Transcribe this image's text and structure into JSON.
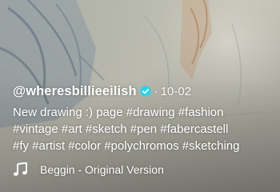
{
  "post": {
    "username": "@wheresbillieeilish",
    "verified": true,
    "separator": "·",
    "date": "10-02",
    "caption_lines": [
      "New drawing :)  page #drawing #fashion",
      "#vintage #art #sketch #pen #fabercastell",
      "#fy #artist #color #polychromos #sketching"
    ]
  },
  "music": {
    "icon": "music-note-icon",
    "title": "Beggin - Original Version"
  },
  "colors": {
    "text": "#ffffff",
    "verified_badge": "#20d5ec"
  }
}
